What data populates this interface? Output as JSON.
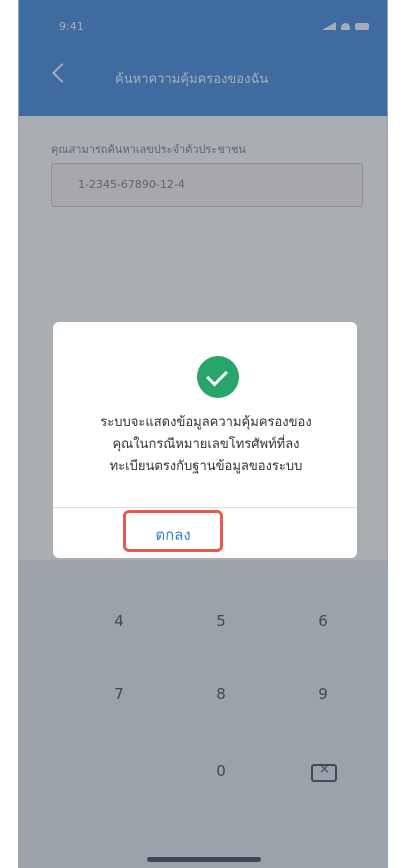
{
  "status_bar": {
    "time": "9:41"
  },
  "header": {
    "title": "ค้นหาความคุ้มครองของฉัน"
  },
  "form": {
    "label": "คุณสามารถค้นหาเลขประจำตัวประชาชน",
    "value": "1-2345-67890-12-4"
  },
  "keypad": {
    "keys": [
      "4",
      "5",
      "6",
      "7",
      "8",
      "9",
      "0"
    ]
  },
  "dialog": {
    "message_line1": "ระบบจะแสดงข้อมูลความคุ้มครองของ",
    "message_line2": "คุณในกรณีหมายเลขโทรศัพท์ที่ลง",
    "message_line3": "ทะเบียนตรงกับฐานข้อมูลของระบบ",
    "ok_label": "ตกลง"
  },
  "colors": {
    "primary_blue": "#3b7fd3",
    "success_green": "#27a56a",
    "highlight_red": "#e65a4f"
  },
  "icons": [
    "back-icon",
    "check-icon",
    "delete-icon"
  ]
}
